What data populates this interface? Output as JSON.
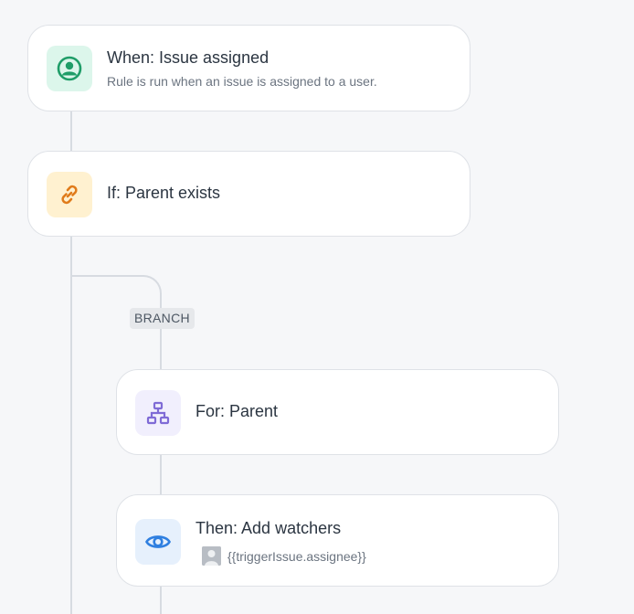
{
  "trigger": {
    "title": "When: Issue assigned",
    "subtitle": "Rule is run when an issue is assigned to a user.",
    "icon": "user-circle-icon",
    "icon_color": "#1f9d68",
    "icon_bg": "#dcf6eb"
  },
  "condition": {
    "title": "If: Parent exists",
    "icon": "link-icon",
    "icon_color": "#e07b1a",
    "icon_bg": "#fff1d0"
  },
  "branch": {
    "badge": "BRANCH"
  },
  "branch_rule": {
    "title": "For: Parent",
    "icon": "hierarchy-icon",
    "icon_color": "#7f6bd6",
    "icon_bg": "#f1effd"
  },
  "action": {
    "title": "Then: Add watchers",
    "watcher_value": "{{triggerIssue.assignee}}",
    "icon": "eye-icon",
    "icon_color": "#2f7fe0",
    "icon_bg": "#e6f0fc"
  }
}
